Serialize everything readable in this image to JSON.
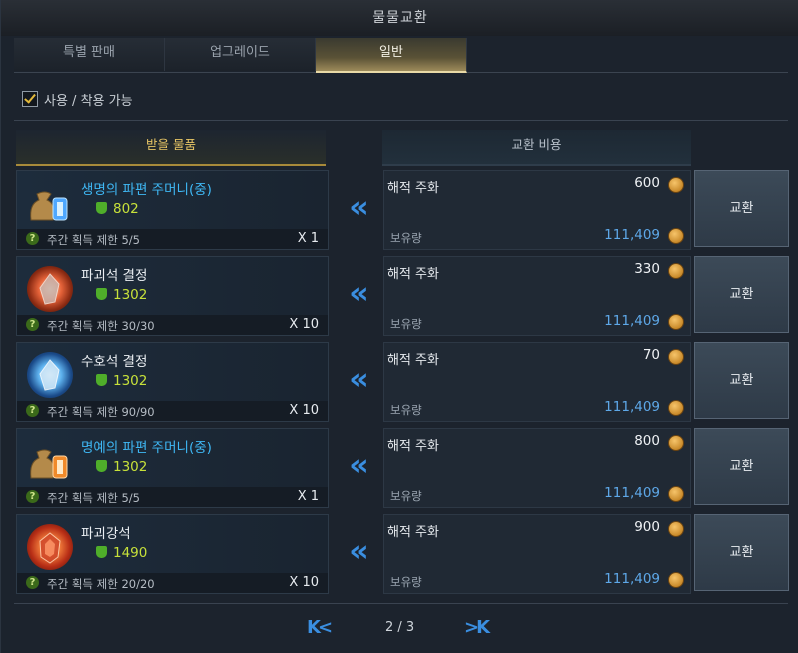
{
  "window": {
    "title": "물물교환"
  },
  "tabs": [
    {
      "label": "특별 판매"
    },
    {
      "label": "업그레이드"
    },
    {
      "label": "일반"
    }
  ],
  "filter": {
    "label": "사용 / 착용 가능",
    "checked": true
  },
  "headers": {
    "receive": "받을 물품",
    "cost": "교환 비용"
  },
  "rows": [
    {
      "name": "생명의 파편 주머니(중)",
      "name_color": "blue",
      "level": "802",
      "limit": "주간 획득 제한 5/5",
      "qty": "X 1",
      "cost_name": "해적 주화",
      "cost_amount": "600",
      "owned_label": "보유량",
      "owned_amount": "111,409",
      "button": "교환",
      "icon": "life-shard-pouch-icon"
    },
    {
      "name": "파괴석 결정",
      "name_color": "white",
      "level": "1302",
      "limit": "주간 획득 제한 30/30",
      "qty": "X 10",
      "cost_name": "해적 주화",
      "cost_amount": "330",
      "owned_label": "보유량",
      "owned_amount": "111,409",
      "button": "교환",
      "icon": "destruction-stone-crystal-icon"
    },
    {
      "name": "수호석 결정",
      "name_color": "white",
      "level": "1302",
      "limit": "주간 획득 제한 90/90",
      "qty": "X 10",
      "cost_name": "해적 주화",
      "cost_amount": "70",
      "owned_label": "보유량",
      "owned_amount": "111,409",
      "button": "교환",
      "icon": "guardian-stone-crystal-icon"
    },
    {
      "name": "명예의 파편 주머니(중)",
      "name_color": "blue",
      "level": "1302",
      "limit": "주간 획득 제한 5/5",
      "qty": "X 1",
      "cost_name": "해적 주화",
      "cost_amount": "800",
      "owned_label": "보유량",
      "owned_amount": "111,409",
      "button": "교환",
      "icon": "honor-shard-pouch-icon"
    },
    {
      "name": "파괴강석",
      "name_color": "white",
      "level": "1490",
      "limit": "주간 획득 제한 20/20",
      "qty": "X 10",
      "cost_name": "해적 주화",
      "cost_amount": "900",
      "owned_label": "보유량",
      "owned_amount": "111,409",
      "button": "교환",
      "icon": "obliteration-stone-icon"
    }
  ],
  "pagination": {
    "first": "K<",
    "last": ">K",
    "current": "2 / 3"
  },
  "colors": {
    "accent_blue": "#3a8ee0",
    "gold": "#e7c565",
    "level_green": "#c7e13a",
    "item_blue": "#3fb8f5"
  }
}
